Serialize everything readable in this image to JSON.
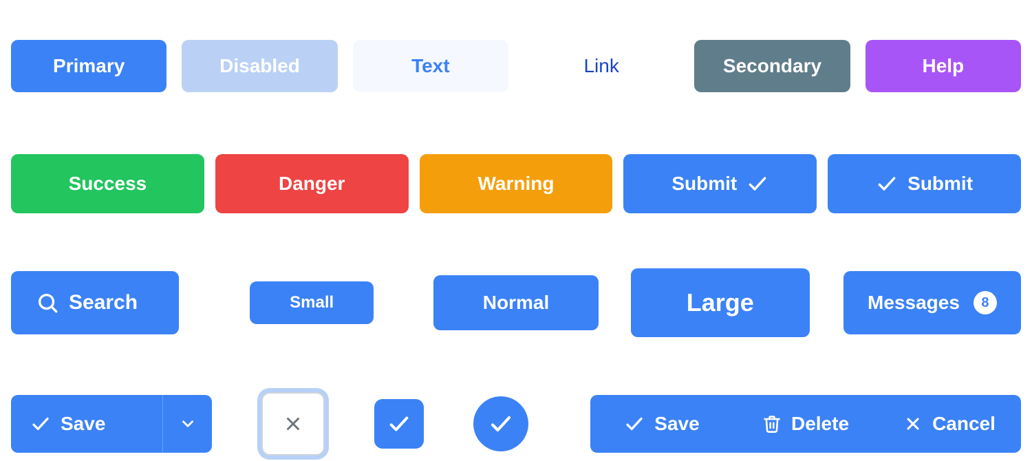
{
  "colors": {
    "primary": "#3B82F6",
    "disabled": "#BAD1F5",
    "textBg": "#F5F9FF",
    "link": "#1945C4",
    "secondary": "#607D8B",
    "help": "#A855F7",
    "success": "#22C55E",
    "danger": "#EF4444",
    "warning": "#F59E0B"
  },
  "row1": {
    "primary": "Primary",
    "disabled": "Disabled",
    "text": "Text",
    "link": "Link",
    "secondary": "Secondary",
    "help": "Help"
  },
  "row2": {
    "success": "Success",
    "danger": "Danger",
    "warning": "Warning",
    "submit_icon_right": "Submit",
    "submit_icon_left": "Submit"
  },
  "row3": {
    "search": "Search",
    "small": "Small",
    "normal": "Normal",
    "large": "Large",
    "messages": "Messages",
    "messages_badge": "8"
  },
  "row4": {
    "split_save": "Save",
    "set_save": "Save",
    "set_delete": "Delete",
    "set_cancel": "Cancel"
  }
}
